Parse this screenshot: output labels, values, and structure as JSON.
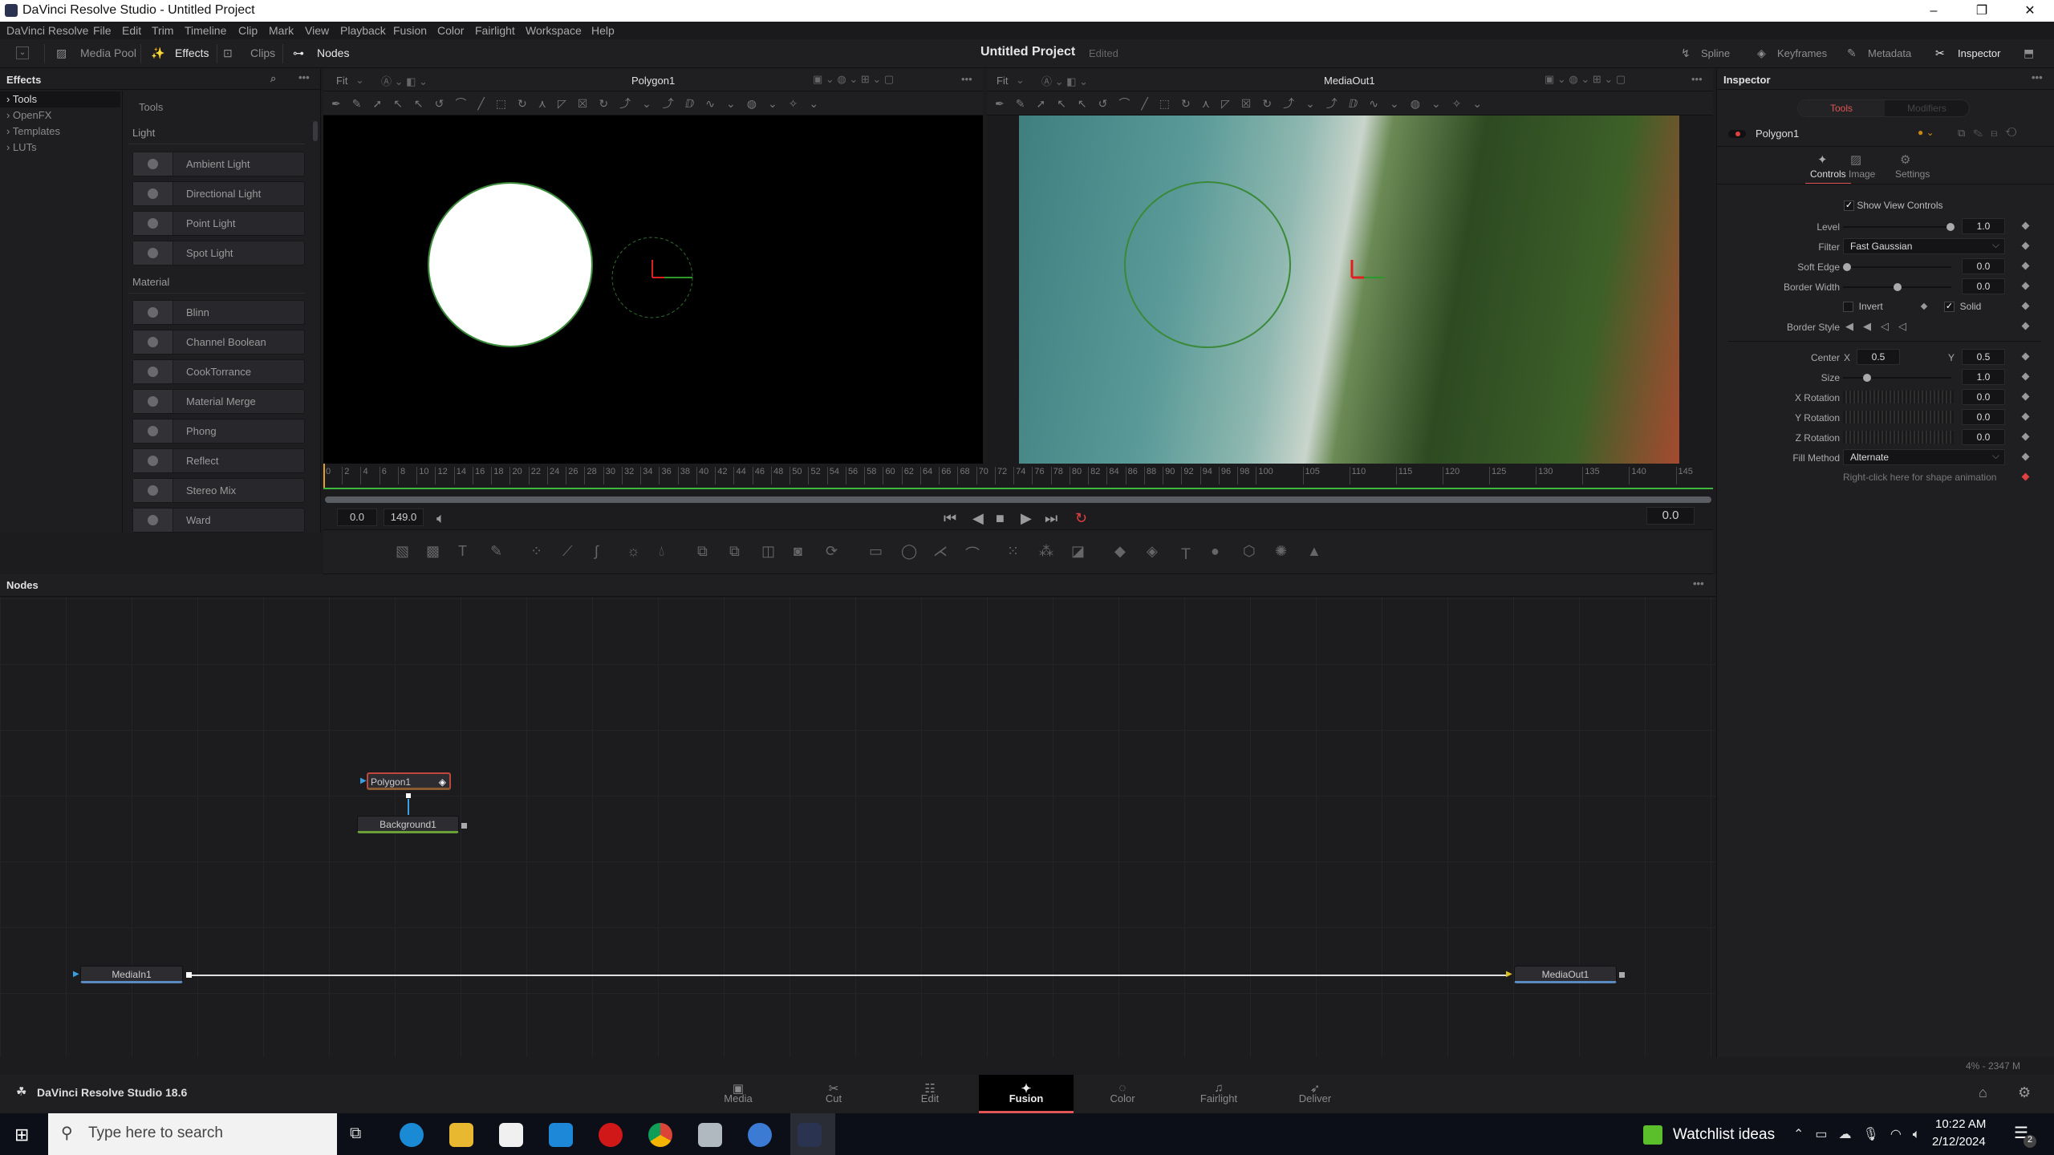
{
  "window": {
    "title": "DaVinci Resolve Studio - Untitled Project",
    "minimize": "–",
    "maximize": "❐",
    "close": "✕"
  },
  "menu": [
    "DaVinci Resolve",
    "File",
    "Edit",
    "Trim",
    "Timeline",
    "Clip",
    "Mark",
    "View",
    "Playback",
    "Fusion",
    "Color",
    "Fairlight",
    "Workspace",
    "Help"
  ],
  "toolbar": {
    "media_pool": "Media Pool",
    "effects": "Effects",
    "clips": "Clips",
    "nodes": "Nodes",
    "project_title": "Untitled Project",
    "project_status": "Edited",
    "spline": "Spline",
    "keyframes": "Keyframes",
    "metadata": "Metadata",
    "inspector": "Inspector"
  },
  "effects": {
    "title": "Effects",
    "tree": [
      "Tools",
      "OpenFX",
      "Templates",
      "LUTs"
    ],
    "selected_tree": "Tools",
    "list_title": "Tools",
    "categories": [
      {
        "name": "Light",
        "items": [
          "Ambient Light",
          "Directional Light",
          "Point Light",
          "Spot Light"
        ]
      },
      {
        "name": "Material",
        "items": [
          "Blinn",
          "Channel Boolean",
          "CookTorrance",
          "Material Merge",
          "Phong",
          "Reflect",
          "Stereo Mix",
          "Ward"
        ]
      }
    ]
  },
  "viewer_left": {
    "zoom": "Fit",
    "title": "Polygon1"
  },
  "viewer_right": {
    "zoom": "Fit",
    "title": "MediaOut1"
  },
  "timeline": {
    "ticks": [
      "0",
      "2",
      "4",
      "6",
      "8",
      "10",
      "12",
      "14",
      "16",
      "18",
      "20",
      "22",
      "24",
      "26",
      "28",
      "30",
      "32",
      "34",
      "36",
      "38",
      "40",
      "42",
      "44",
      "46",
      "48",
      "50",
      "52",
      "54",
      "56",
      "58",
      "60",
      "62",
      "64",
      "66",
      "68",
      "70",
      "72",
      "74",
      "76",
      "78",
      "80",
      "82",
      "84",
      "86",
      "88",
      "90",
      "92",
      "94",
      "96",
      "98",
      "100",
      "105",
      "110",
      "115",
      "120",
      "125",
      "130",
      "135",
      "140",
      "145"
    ],
    "start": "0.0",
    "end": "149.0",
    "current": "0.0"
  },
  "nodes": {
    "title": "Nodes",
    "items": [
      {
        "name": "Polygon1",
        "selected": true
      },
      {
        "name": "Background1"
      },
      {
        "name": "MediaIn1"
      },
      {
        "name": "MediaOut1"
      }
    ]
  },
  "inspector": {
    "title": "Inspector",
    "tabs": [
      "Tools",
      "Modifiers"
    ],
    "active_tab": "Tools",
    "node_name": "Polygon1",
    "subtabs": [
      "Controls",
      "Image",
      "Settings"
    ],
    "active_subtab": "Controls",
    "show_view_controls": {
      "label": "Show View Controls",
      "checked": true
    },
    "level": {
      "label": "Level",
      "value": "1.0",
      "slider": 1.0
    },
    "filter": {
      "label": "Filter",
      "value": "Fast Gaussian"
    },
    "soft_edge": {
      "label": "Soft Edge",
      "value": "0.0",
      "slider": 0.0
    },
    "border_width": {
      "label": "Border Width",
      "value": "0.0",
      "slider": 0.5
    },
    "invert": {
      "label": "Invert",
      "checked": false
    },
    "solid": {
      "label": "Solid",
      "checked": true
    },
    "border_style": {
      "label": "Border Style"
    },
    "center": {
      "label": "Center",
      "x_label": "X",
      "x": "0.5",
      "y_label": "Y",
      "y": "0.5"
    },
    "size": {
      "label": "Size",
      "value": "1.0",
      "slider": 0.2
    },
    "x_rotation": {
      "label": "X Rotation",
      "value": "0.0"
    },
    "y_rotation": {
      "label": "Y Rotation",
      "value": "0.0"
    },
    "z_rotation": {
      "label": "Z Rotation",
      "value": "0.0"
    },
    "fill_method": {
      "label": "Fill Method",
      "value": "Alternate"
    },
    "hint": "Right-click here for shape animation"
  },
  "status": {
    "memory": "4% - 2347 M"
  },
  "app_version": "DaVinci Resolve Studio 18.6",
  "pages": [
    {
      "label": "Media",
      "icon": "▣"
    },
    {
      "label": "Cut",
      "icon": "✂"
    },
    {
      "label": "Edit",
      "icon": "☷"
    },
    {
      "label": "Fusion",
      "icon": "✦"
    },
    {
      "label": "Color",
      "icon": "◌"
    },
    {
      "label": "Fairlight",
      "icon": "♫"
    },
    {
      "label": "Deliver",
      "icon": "➶"
    }
  ],
  "active_page": "Fusion",
  "taskbar": {
    "search_placeholder": "Type here to search",
    "widget": "Watchlist ideas",
    "time": "10:22 AM",
    "date": "2/12/2024",
    "notifications": "2"
  },
  "colors": {
    "accent": "#e05555",
    "selection_green": "#3db83d",
    "node_selected": "#c0453a"
  }
}
